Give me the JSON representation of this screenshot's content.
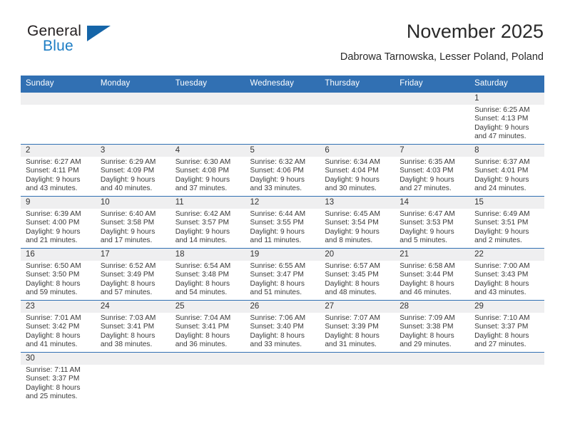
{
  "brand": {
    "name_top": "General",
    "name_bottom": "Blue",
    "triangle_color": "#1565a8",
    "blue_color": "#1d7dc4"
  },
  "header": {
    "month_title": "November 2025",
    "location": "Dabrowa Tarnowska, Lesser Poland, Poland"
  },
  "theme": {
    "header_bg": "#3170b3",
    "header_text": "#ffffff",
    "daynum_band_bg": "#efeff0",
    "row_divider": "#3170b3"
  },
  "weekdays": [
    "Sunday",
    "Monday",
    "Tuesday",
    "Wednesday",
    "Thursday",
    "Friday",
    "Saturday"
  ],
  "labels": {
    "sunrise_prefix": "Sunrise:",
    "sunset_prefix": "Sunset:",
    "daylight_prefix": "Daylight:"
  },
  "weeks": [
    [
      {
        "empty": true
      },
      {
        "empty": true
      },
      {
        "empty": true
      },
      {
        "empty": true
      },
      {
        "empty": true
      },
      {
        "empty": true
      },
      {
        "day": "1",
        "sunrise": "Sunrise: 6:25 AM",
        "sunset": "Sunset: 4:13 PM",
        "daylight1": "Daylight: 9 hours",
        "daylight2": "and 47 minutes."
      }
    ],
    [
      {
        "day": "2",
        "sunrise": "Sunrise: 6:27 AM",
        "sunset": "Sunset: 4:11 PM",
        "daylight1": "Daylight: 9 hours",
        "daylight2": "and 43 minutes."
      },
      {
        "day": "3",
        "sunrise": "Sunrise: 6:29 AM",
        "sunset": "Sunset: 4:09 PM",
        "daylight1": "Daylight: 9 hours",
        "daylight2": "and 40 minutes."
      },
      {
        "day": "4",
        "sunrise": "Sunrise: 6:30 AM",
        "sunset": "Sunset: 4:08 PM",
        "daylight1": "Daylight: 9 hours",
        "daylight2": "and 37 minutes."
      },
      {
        "day": "5",
        "sunrise": "Sunrise: 6:32 AM",
        "sunset": "Sunset: 4:06 PM",
        "daylight1": "Daylight: 9 hours",
        "daylight2": "and 33 minutes."
      },
      {
        "day": "6",
        "sunrise": "Sunrise: 6:34 AM",
        "sunset": "Sunset: 4:04 PM",
        "daylight1": "Daylight: 9 hours",
        "daylight2": "and 30 minutes."
      },
      {
        "day": "7",
        "sunrise": "Sunrise: 6:35 AM",
        "sunset": "Sunset: 4:03 PM",
        "daylight1": "Daylight: 9 hours",
        "daylight2": "and 27 minutes."
      },
      {
        "day": "8",
        "sunrise": "Sunrise: 6:37 AM",
        "sunset": "Sunset: 4:01 PM",
        "daylight1": "Daylight: 9 hours",
        "daylight2": "and 24 minutes."
      }
    ],
    [
      {
        "day": "9",
        "sunrise": "Sunrise: 6:39 AM",
        "sunset": "Sunset: 4:00 PM",
        "daylight1": "Daylight: 9 hours",
        "daylight2": "and 21 minutes."
      },
      {
        "day": "10",
        "sunrise": "Sunrise: 6:40 AM",
        "sunset": "Sunset: 3:58 PM",
        "daylight1": "Daylight: 9 hours",
        "daylight2": "and 17 minutes."
      },
      {
        "day": "11",
        "sunrise": "Sunrise: 6:42 AM",
        "sunset": "Sunset: 3:57 PM",
        "daylight1": "Daylight: 9 hours",
        "daylight2": "and 14 minutes."
      },
      {
        "day": "12",
        "sunrise": "Sunrise: 6:44 AM",
        "sunset": "Sunset: 3:55 PM",
        "daylight1": "Daylight: 9 hours",
        "daylight2": "and 11 minutes."
      },
      {
        "day": "13",
        "sunrise": "Sunrise: 6:45 AM",
        "sunset": "Sunset: 3:54 PM",
        "daylight1": "Daylight: 9 hours",
        "daylight2": "and 8 minutes."
      },
      {
        "day": "14",
        "sunrise": "Sunrise: 6:47 AM",
        "sunset": "Sunset: 3:53 PM",
        "daylight1": "Daylight: 9 hours",
        "daylight2": "and 5 minutes."
      },
      {
        "day": "15",
        "sunrise": "Sunrise: 6:49 AM",
        "sunset": "Sunset: 3:51 PM",
        "daylight1": "Daylight: 9 hours",
        "daylight2": "and 2 minutes."
      }
    ],
    [
      {
        "day": "16",
        "sunrise": "Sunrise: 6:50 AM",
        "sunset": "Sunset: 3:50 PM",
        "daylight1": "Daylight: 8 hours",
        "daylight2": "and 59 minutes."
      },
      {
        "day": "17",
        "sunrise": "Sunrise: 6:52 AM",
        "sunset": "Sunset: 3:49 PM",
        "daylight1": "Daylight: 8 hours",
        "daylight2": "and 57 minutes."
      },
      {
        "day": "18",
        "sunrise": "Sunrise: 6:54 AM",
        "sunset": "Sunset: 3:48 PM",
        "daylight1": "Daylight: 8 hours",
        "daylight2": "and 54 minutes."
      },
      {
        "day": "19",
        "sunrise": "Sunrise: 6:55 AM",
        "sunset": "Sunset: 3:47 PM",
        "daylight1": "Daylight: 8 hours",
        "daylight2": "and 51 minutes."
      },
      {
        "day": "20",
        "sunrise": "Sunrise: 6:57 AM",
        "sunset": "Sunset: 3:45 PM",
        "daylight1": "Daylight: 8 hours",
        "daylight2": "and 48 minutes."
      },
      {
        "day": "21",
        "sunrise": "Sunrise: 6:58 AM",
        "sunset": "Sunset: 3:44 PM",
        "daylight1": "Daylight: 8 hours",
        "daylight2": "and 46 minutes."
      },
      {
        "day": "22",
        "sunrise": "Sunrise: 7:00 AM",
        "sunset": "Sunset: 3:43 PM",
        "daylight1": "Daylight: 8 hours",
        "daylight2": "and 43 minutes."
      }
    ],
    [
      {
        "day": "23",
        "sunrise": "Sunrise: 7:01 AM",
        "sunset": "Sunset: 3:42 PM",
        "daylight1": "Daylight: 8 hours",
        "daylight2": "and 41 minutes."
      },
      {
        "day": "24",
        "sunrise": "Sunrise: 7:03 AM",
        "sunset": "Sunset: 3:41 PM",
        "daylight1": "Daylight: 8 hours",
        "daylight2": "and 38 minutes."
      },
      {
        "day": "25",
        "sunrise": "Sunrise: 7:04 AM",
        "sunset": "Sunset: 3:41 PM",
        "daylight1": "Daylight: 8 hours",
        "daylight2": "and 36 minutes."
      },
      {
        "day": "26",
        "sunrise": "Sunrise: 7:06 AM",
        "sunset": "Sunset: 3:40 PM",
        "daylight1": "Daylight: 8 hours",
        "daylight2": "and 33 minutes."
      },
      {
        "day": "27",
        "sunrise": "Sunrise: 7:07 AM",
        "sunset": "Sunset: 3:39 PM",
        "daylight1": "Daylight: 8 hours",
        "daylight2": "and 31 minutes."
      },
      {
        "day": "28",
        "sunrise": "Sunrise: 7:09 AM",
        "sunset": "Sunset: 3:38 PM",
        "daylight1": "Daylight: 8 hours",
        "daylight2": "and 29 minutes."
      },
      {
        "day": "29",
        "sunrise": "Sunrise: 7:10 AM",
        "sunset": "Sunset: 3:37 PM",
        "daylight1": "Daylight: 8 hours",
        "daylight2": "and 27 minutes."
      }
    ],
    [
      {
        "day": "30",
        "sunrise": "Sunrise: 7:11 AM",
        "sunset": "Sunset: 3:37 PM",
        "daylight1": "Daylight: 8 hours",
        "daylight2": "and 25 minutes."
      },
      {
        "empty": true
      },
      {
        "empty": true
      },
      {
        "empty": true
      },
      {
        "empty": true
      },
      {
        "empty": true
      },
      {
        "empty": true
      }
    ]
  ]
}
